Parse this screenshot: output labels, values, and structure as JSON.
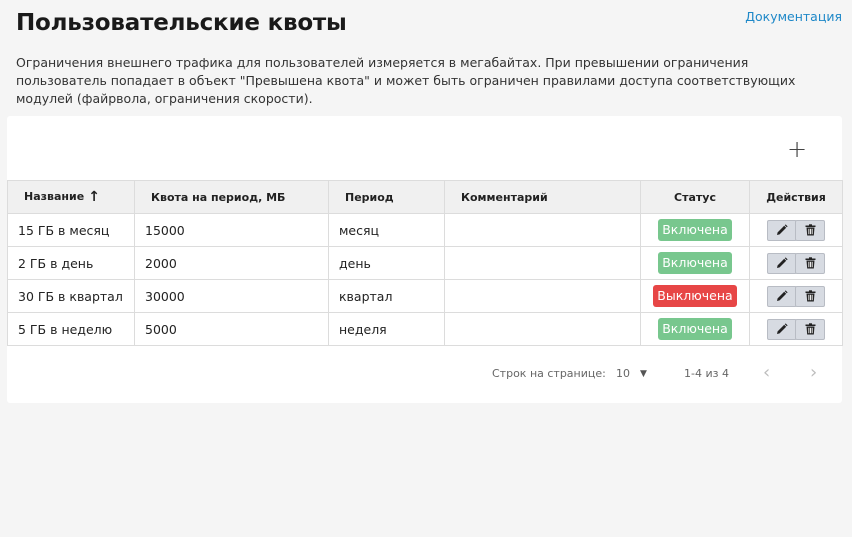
{
  "header": {
    "title": "Пользовательские квоты",
    "doc_link": "Документация"
  },
  "description": "Ограничения внешнего трафика для пользователей измеряется в мегабайтах. При превышении ограничения пользователь попадает в объект \"Превышена квота\" и может быть ограничен правилами доступа соответствующих модулей (файрвола, ограничения скорости).",
  "toolbar": {
    "add_icon": "plus-icon"
  },
  "table": {
    "columns": {
      "name": "Название",
      "quota": "Квота на период, МБ",
      "period": "Период",
      "comment": "Комментарий",
      "status": "Статус",
      "actions": "Действия"
    },
    "sort": {
      "column": "name",
      "direction": "ascending"
    },
    "rows": [
      {
        "name": "15 ГБ в месяц",
        "quota": "15000",
        "period": "месяц",
        "comment": "",
        "status": "Включена",
        "enabled": true
      },
      {
        "name": "2 ГБ в день",
        "quota": "2000",
        "period": "день",
        "comment": "",
        "status": "Включена",
        "enabled": true
      },
      {
        "name": "30 ГБ в квартал",
        "quota": "30000",
        "period": "квартал",
        "comment": "",
        "status": "Выключена",
        "enabled": false
      },
      {
        "name": "5 ГБ в неделю",
        "quota": "5000",
        "period": "неделя",
        "comment": "",
        "status": "Включена",
        "enabled": true
      }
    ]
  },
  "pagination": {
    "rows_per_page_label": "Строк на странице:",
    "rows_per_page": "10",
    "range": "1-4 из 4"
  },
  "colors": {
    "status_enabled": "#78c78e",
    "status_disabled": "#e74646",
    "link": "#1e88c8"
  }
}
